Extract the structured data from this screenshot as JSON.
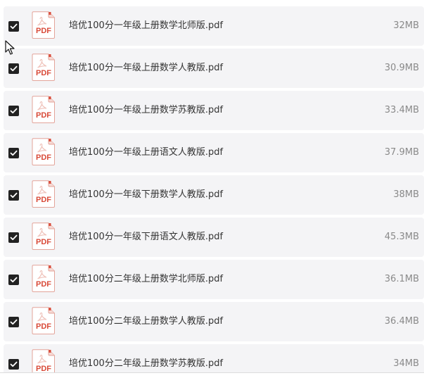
{
  "files": [
    {
      "name": "培优100分一年级上册数学北师版.pdf",
      "size": "32MB",
      "checked": true
    },
    {
      "name": "培优100分一年级上册数学人教版.pdf",
      "size": "30.9MB",
      "checked": true
    },
    {
      "name": "培优100分一年级上册数学苏教版.pdf",
      "size": "33.4MB",
      "checked": true
    },
    {
      "name": "培优100分一年级上册语文人教版.pdf",
      "size": "37.9MB",
      "checked": true
    },
    {
      "name": "培优100分一年级下册数学人教版.pdf",
      "size": "38MB",
      "checked": true
    },
    {
      "name": "培优100分一年级下册语文人教版.pdf",
      "size": "45.3MB",
      "checked": true
    },
    {
      "name": "培优100分二年级上册数学北师版.pdf",
      "size": "36.1MB",
      "checked": true
    },
    {
      "name": "培优100分二年级上册数学人教版.pdf",
      "size": "36.4MB",
      "checked": true
    },
    {
      "name": "培优100分二年级上册数学苏教版.pdf",
      "size": "34MB",
      "checked": true
    }
  ],
  "file_icon": {
    "name": "pdf-file-icon",
    "label": "PDF",
    "color": "#d94a38"
  },
  "checkbox_color": "#222222"
}
